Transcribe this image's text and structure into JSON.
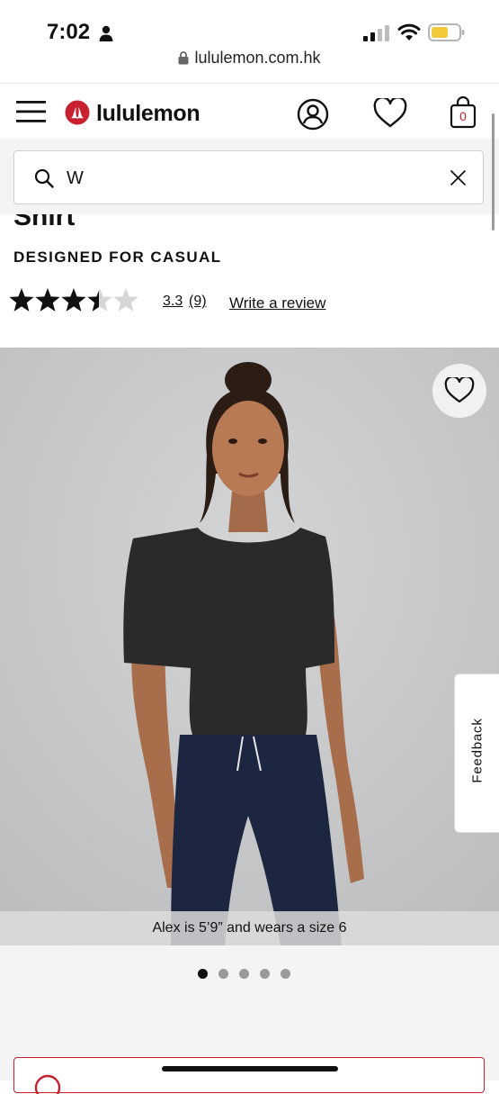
{
  "status_bar": {
    "time": "7:02",
    "url": "lululemon.com.hk"
  },
  "header": {
    "brand": "lululemon",
    "cart_count": "0"
  },
  "search": {
    "value": "W"
  },
  "product": {
    "title_partial": "Shirt",
    "subtitle": "DESIGNED FOR CASUAL",
    "rating_value": "3.3",
    "rating_count": "(9)",
    "rating_stars": 3.3,
    "write_review": "Write a review",
    "image_caption": "Alex is 5’9” and wears a size 6"
  },
  "feedback_label": "Feedback",
  "carousel": {
    "total": 5,
    "active": 1
  },
  "colors": {
    "brand_red": "#c8202f",
    "text": "#111111",
    "photo_bg": "#c9cacb"
  },
  "icons": [
    "person-icon",
    "signal-icon",
    "wifi-icon",
    "battery-icon",
    "lock-icon",
    "menu-icon",
    "lululemon-logo-icon",
    "account-icon",
    "heart-icon",
    "bag-icon",
    "search-icon",
    "close-icon",
    "star-icon",
    "wishlist-heart-icon",
    "alert-icon"
  ]
}
